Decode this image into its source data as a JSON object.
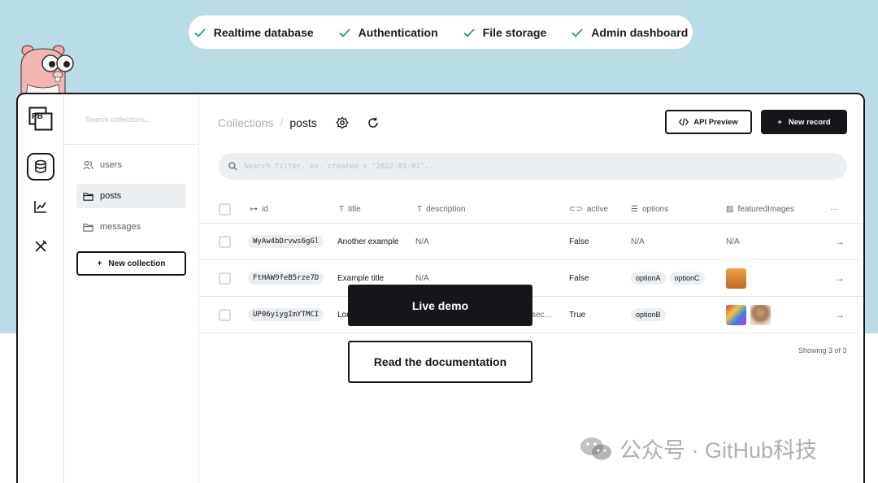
{
  "features": [
    {
      "label": "Realtime database",
      "icon": "check-icon"
    },
    {
      "label": "Authentication",
      "icon": "check-icon"
    },
    {
      "label": "File storage",
      "icon": "check-icon"
    },
    {
      "label": "Admin dashboard",
      "icon": "check-icon"
    }
  ],
  "colors": {
    "accent": "#16161a",
    "check": "#3e9c8a",
    "sky": "#b8dde6",
    "muted": "#5b6570"
  },
  "logo": {
    "text": "PB"
  },
  "sidebar": {
    "search_placeholder": "Search collections...",
    "items": [
      {
        "label": "users",
        "icon": "users-icon"
      },
      {
        "label": "posts",
        "icon": "folder-icon"
      },
      {
        "label": "messages",
        "icon": "folder-icon"
      }
    ],
    "new_collection": "New collection"
  },
  "header": {
    "breadcrumb_root": "Collections",
    "breadcrumb_separator": "/",
    "collection": "posts",
    "api_preview": "API Preview",
    "new_record": "New record"
  },
  "filter": {
    "placeholder": "Search filter, ex. created > \"2022-01-01\"..."
  },
  "table": {
    "columns": [
      {
        "label": "id",
        "icon": "key-icon"
      },
      {
        "label": "title",
        "icon": "text-icon"
      },
      {
        "label": "description",
        "icon": "text-icon"
      },
      {
        "label": "active",
        "icon": "toggle-icon"
      },
      {
        "label": "options",
        "icon": "list-icon"
      },
      {
        "label": "featuredImages",
        "icon": "image-icon"
      }
    ],
    "more": "···",
    "rows": [
      {
        "id": "WyAw4bDrvws6gGl",
        "title": "Another example",
        "description": "N/A",
        "active": "False",
        "options": [
          "N/A"
        ],
        "images": "N/A"
      },
      {
        "id": "FtHAW9feB5rze7D",
        "title": "Example title",
        "description": "N/A",
        "active": "False",
        "options": [
          "optionA",
          "optionC"
        ],
        "images": ""
      },
      {
        "id": "UP06yiygImYTMCI",
        "title": "Lor",
        "description": "sec…",
        "active": "True",
        "options": [
          "optionB"
        ],
        "images": ""
      }
    ],
    "showing": "Showing 3 of 3"
  },
  "cta": {
    "live_demo": "Live demo",
    "read_docs": "Read the documentation"
  },
  "watermark": {
    "text": "公众号 · GitHub科技"
  }
}
